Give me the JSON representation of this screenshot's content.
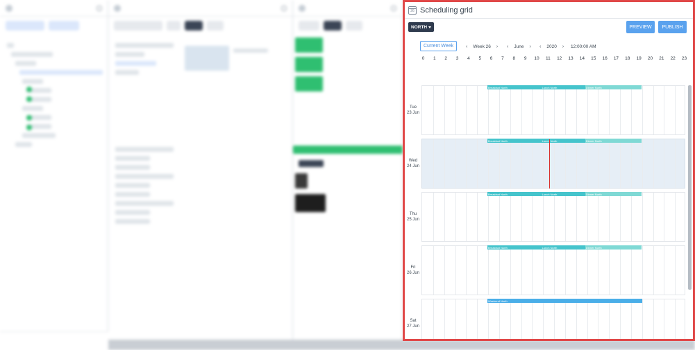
{
  "panel": {
    "title": "Scheduling grid",
    "calendar_icon_text": "26",
    "icon": "calendar-icon"
  },
  "toolbar": {
    "region_label": "NORTH",
    "preview_label": "PREVIEW",
    "publish_label": "PUBLISH"
  },
  "nav": {
    "current_week_label": "Current Week",
    "week_label": "Week 26",
    "month_label": "June",
    "year_label": "2020",
    "time_label": "12:00:00 AM",
    "prev_glyph": "‹",
    "next_glyph": "›"
  },
  "hours": [
    "0",
    "1",
    "2",
    "3",
    "4",
    "5",
    "6",
    "7",
    "8",
    "9",
    "10",
    "11",
    "12",
    "13",
    "14",
    "15",
    "16",
    "17",
    "18",
    "19",
    "20",
    "21",
    "22",
    "23"
  ],
  "days": [
    {
      "weekday": "Tue",
      "date": "23 Jun",
      "highlight": false,
      "bars": [
        {
          "label": "Breakfast North",
          "start": 6,
          "end": 10.9,
          "color": "#45c4cc"
        },
        {
          "label": "Lunch North",
          "start": 10.9,
          "end": 14.9,
          "color": "#45c4cc"
        },
        {
          "label": "Dinner North",
          "start": 14.9,
          "end": 20,
          "color": "#7fd9d5"
        }
      ]
    },
    {
      "weekday": "Wed",
      "date": "24 Jun",
      "highlight": true,
      "bars": [
        {
          "label": "Breakfast North",
          "start": 6,
          "end": 10.9,
          "color": "#45c4cc"
        },
        {
          "label": "Lunch North",
          "start": 10.9,
          "end": 14.9,
          "color": "#45c4cc"
        },
        {
          "label": "Dinner North",
          "start": 14.9,
          "end": 20,
          "color": "#7fd9d5"
        }
      ]
    },
    {
      "weekday": "Thu",
      "date": "25 Jun",
      "highlight": false,
      "bars": [
        {
          "label": "Breakfast North",
          "start": 6,
          "end": 10.9,
          "color": "#45c4cc"
        },
        {
          "label": "Lunch North",
          "start": 10.9,
          "end": 14.9,
          "color": "#45c4cc"
        },
        {
          "label": "Dinner North",
          "start": 14.9,
          "end": 20,
          "color": "#7fd9d5"
        }
      ]
    },
    {
      "weekday": "Fri",
      "date": "26 Jun",
      "highlight": false,
      "bars": [
        {
          "label": "Breakfast North",
          "start": 6,
          "end": 10.9,
          "color": "#45c4cc"
        },
        {
          "label": "Lunch North",
          "start": 10.9,
          "end": 14.9,
          "color": "#45c4cc"
        },
        {
          "label": "Dinner North",
          "start": 14.9,
          "end": 20,
          "color": "#7fd9d5"
        }
      ]
    },
    {
      "weekday": "Sat",
      "date": "27 Jun",
      "highlight": false,
      "bars": [
        {
          "label": "Weekend North",
          "start": 6,
          "end": 20.1,
          "color": "#4aaee8"
        }
      ]
    }
  ],
  "now_marker": {
    "day_index": 1,
    "hour": 11.6,
    "color": "#d9302c"
  },
  "colors": {
    "accent": "#5aa2ee",
    "frame": "#e04848",
    "region_bg": "#2f3b4e"
  }
}
